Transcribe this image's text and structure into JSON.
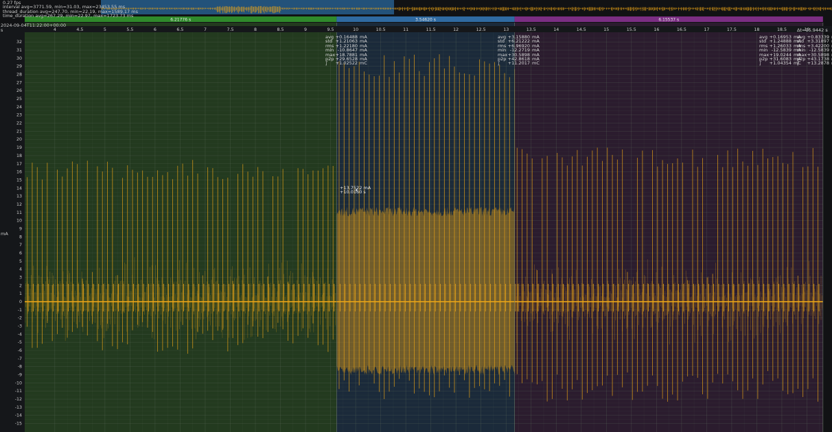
{
  "stats_overlay": {
    "fps": "0.27 fps",
    "interval": "interval avg=3771.59, min=31.03, max=23453.55 ms",
    "thread_duration": "thread_duration avg=247.70, min=22.19, max=1589.17 ms",
    "time_duration": "time_duration avg=267.29, min=22.97, max=1723.73 ms"
  },
  "timestamp": "2024-09-04T11:22:00+00:00",
  "x_unit": "s",
  "y_unit": "mA",
  "regions": [
    {
      "label": "6.21776 s",
      "start": 3.4,
      "end": 9.62,
      "fill": "#233a1f",
      "header": "#2f8a2b"
    },
    {
      "label": "3.54620 s",
      "start": 9.62,
      "end": 13.17,
      "fill": "#1b2a3a",
      "header": "#2f6aa1"
    },
    {
      "label": "6.15537 s",
      "start": 13.17,
      "end": 19.32,
      "fill": "#2b1c2e",
      "header": "#7b2e83"
    }
  ],
  "region_stats": [
    {
      "rows": [
        [
          "avg",
          "+0.16488",
          "mA"
        ],
        [
          "std",
          "+1.21063",
          "mA"
        ],
        [
          "rms",
          "+1.22180",
          "mA"
        ],
        [
          "min",
          "-10.8647",
          "mA"
        ],
        [
          "max",
          "+18.7881",
          "mA"
        ],
        [
          "p2p",
          "+29.6528",
          "mA"
        ],
        [
          "∫",
          "+1.02522",
          "mC"
        ]
      ]
    },
    {
      "rows": [
        [
          "avg",
          "+3.15880",
          "mA"
        ],
        [
          "std",
          "+6.21222",
          "mA"
        ],
        [
          "rms",
          "+6.96920",
          "mA"
        ],
        [
          "min",
          "-12.2719",
          "mA"
        ],
        [
          "max",
          "+30.5898",
          "mA"
        ],
        [
          "p2p",
          "+42.8618",
          "mA"
        ],
        [
          "∫",
          "+11.2017",
          "mC"
        ]
      ]
    },
    {
      "rows": [
        [
          "avg",
          "+0.16953",
          "mA"
        ],
        [
          "std",
          "+1.24888",
          "mA"
        ],
        [
          "rms",
          "+1.26033",
          "mA"
        ],
        [
          "min",
          "-12.5839",
          "mA"
        ],
        [
          "max",
          "+19.0244",
          "mA"
        ],
        [
          "p2p",
          "+31.6083",
          "mA"
        ],
        [
          "∫",
          "+1.04354",
          "mC"
        ]
      ]
    }
  ],
  "total_stats": {
    "dt": "Δt=15.9442 s",
    "rows": [
      [
        "avg",
        "+0.83339",
        "mA"
      ],
      [
        "std",
        "+3.31897",
        "mA"
      ],
      [
        "rms",
        "+3.42200",
        "mA"
      ],
      [
        "min",
        "-12.5839",
        "mA"
      ],
      [
        "max",
        "+30.5898",
        "mA"
      ],
      [
        "p2p",
        "+43.1738",
        "mA"
      ],
      [
        "∫",
        "+13.2878",
        "mC"
      ]
    ]
  },
  "cursor": {
    "value": "+13.7522 mA",
    "time": "+10.0160 s"
  },
  "colors": {
    "trace": "#e8a317",
    "grid": "#3c4a3c",
    "background": "#111214"
  },
  "chart_data": {
    "type": "line",
    "xlim": [
      3.4,
      19.5
    ],
    "ylim": [
      -15.8,
      33.2
    ],
    "xticks": [
      4,
      4.5,
      5,
      5.5,
      6,
      6.5,
      7,
      7.5,
      8,
      8.5,
      9,
      9.5,
      10,
      10.5,
      11,
      11.5,
      12,
      12.5,
      13,
      13.5,
      14,
      14.5,
      15,
      15.5,
      16,
      16.5,
      17,
      17.5,
      18,
      18.5,
      19
    ],
    "yticks": [
      -15,
      -14,
      -13,
      -12,
      -11,
      -10,
      -9,
      -8,
      -7,
      -6,
      -5,
      -4,
      -3,
      -2,
      -1,
      0,
      1,
      2,
      3,
      4,
      5,
      6,
      7,
      8,
      9,
      10,
      11,
      12,
      13,
      14,
      15,
      16,
      17,
      18,
      19,
      20,
      21,
      22,
      23,
      24,
      25,
      26,
      27,
      28,
      29,
      30,
      31,
      32
    ],
    "grid": true,
    "series": [
      {
        "segments": [
          {
            "x_start": 3.4,
            "x_end": 9.62,
            "baseline": 0.16,
            "pulse_period": 0.1,
            "pulse_max": 17.5,
            "pulse_min": -6.5,
            "noise": 1.2
          },
          {
            "x_start": 9.62,
            "x_end": 13.17,
            "baseline": 3.16,
            "pulse_period": 0.1,
            "pulse_max": 30.5,
            "pulse_min": -12.2,
            "noise": 6.2
          },
          {
            "x_start": 13.17,
            "x_end": 19.32,
            "baseline": 0.17,
            "pulse_period": 0.1,
            "pulse_max": 19.0,
            "pulse_min": -12.5,
            "noise": 1.25
          }
        ]
      }
    ]
  }
}
